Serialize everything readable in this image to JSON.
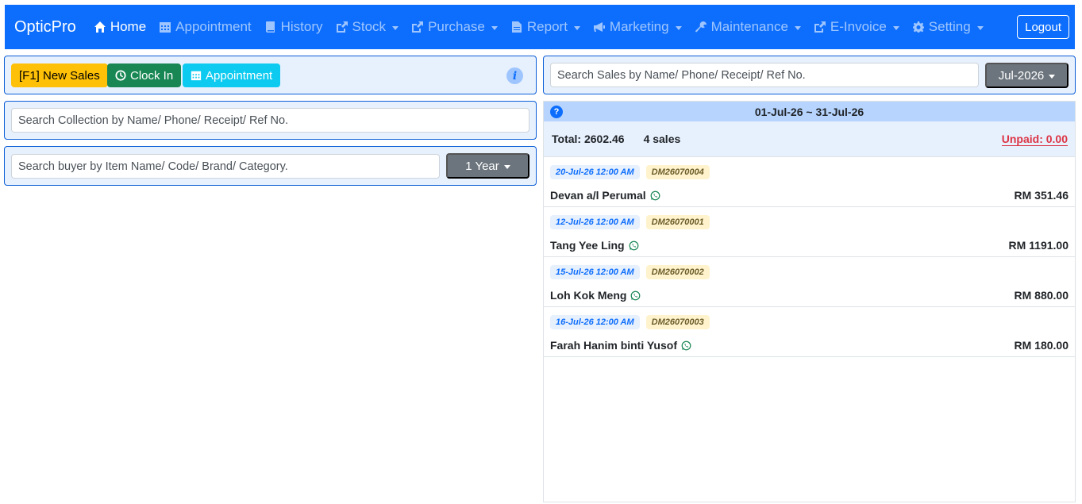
{
  "navbar": {
    "brand": "OpticPro",
    "items": [
      {
        "label": "Home",
        "icon": "home-icon",
        "active": true,
        "dropdown": false
      },
      {
        "label": "Appointment",
        "icon": "calendar-icon",
        "active": false,
        "dropdown": false
      },
      {
        "label": "History",
        "icon": "book-icon",
        "active": false,
        "dropdown": false
      },
      {
        "label": "Stock",
        "icon": "share-icon",
        "active": false,
        "dropdown": true
      },
      {
        "label": "Purchase",
        "icon": "share-icon",
        "active": false,
        "dropdown": true
      },
      {
        "label": "Report",
        "icon": "file-icon",
        "active": false,
        "dropdown": true
      },
      {
        "label": "Marketing",
        "icon": "megaphone-icon",
        "active": false,
        "dropdown": true
      },
      {
        "label": "Maintenance",
        "icon": "wrench-icon",
        "active": false,
        "dropdown": true
      },
      {
        "label": "E-Invoice",
        "icon": "share-icon",
        "active": false,
        "dropdown": true
      },
      {
        "label": "Setting",
        "icon": "gear-icon",
        "active": false,
        "dropdown": true
      }
    ],
    "logout_label": "Logout"
  },
  "actions": {
    "new_sales_label": "[F1] New Sales",
    "clock_in_label": "Clock In",
    "appointment_label": "Appointment"
  },
  "collection_search": {
    "placeholder": "Search Collection by Name/ Phone/ Receipt/ Ref No."
  },
  "buyer_search": {
    "placeholder": "Search buyer by Item Name/ Code/ Brand/ Category.",
    "period_label": "1 Year"
  },
  "sales_search": {
    "placeholder": "Search Sales by Name/ Phone/ Receipt/ Ref No.",
    "month_label": "Jul-2026"
  },
  "sales": {
    "date_range": "01-Jul-26 ~ 31-Jul-26",
    "total": "Total: 2602.46",
    "count": "4 sales",
    "unpaid": "Unpaid: 0.00",
    "rows": [
      {
        "date": "20-Jul-26 12:00 AM",
        "ref": "DM26070004",
        "customer": "Devan a/l Perumal",
        "amount": "RM 351.46"
      },
      {
        "date": "12-Jul-26 12:00 AM",
        "ref": "DM26070001",
        "customer": "Tang Yee Ling",
        "amount": "RM 1191.00"
      },
      {
        "date": "15-Jul-26 12:00 AM",
        "ref": "DM26070002",
        "customer": "Loh Kok Meng",
        "amount": "RM 880.00"
      },
      {
        "date": "16-Jul-26 12:00 AM",
        "ref": "DM26070003",
        "customer": "Farah Hanim binti Yusof",
        "amount": "RM 180.00"
      }
    ]
  },
  "colors": {
    "primary": "#0d6efd",
    "warning": "#ffc107",
    "success": "#198754",
    "info": "#0dcaf0",
    "danger": "#dc3545"
  }
}
